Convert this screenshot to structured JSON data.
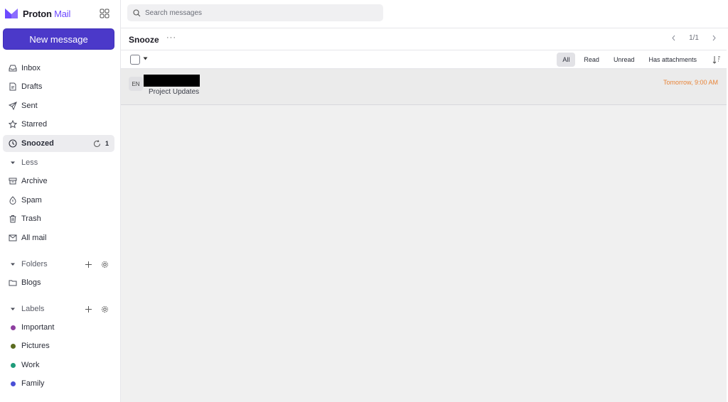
{
  "app": {
    "brand_name": "Proton",
    "brand_product": "Mail"
  },
  "sidebar": {
    "new_message_label": "New message",
    "items": [
      {
        "label": "Inbox",
        "icon": "inbox-icon"
      },
      {
        "label": "Drafts",
        "icon": "drafts-icon"
      },
      {
        "label": "Sent",
        "icon": "sent-icon"
      },
      {
        "label": "Starred",
        "icon": "star-icon"
      },
      {
        "label": "Snoozed",
        "icon": "clock-icon",
        "count": "1",
        "active": true
      },
      {
        "label": "Less",
        "icon": "caret-down-icon"
      },
      {
        "label": "Archive",
        "icon": "archive-icon"
      },
      {
        "label": "Spam",
        "icon": "spam-icon"
      },
      {
        "label": "Trash",
        "icon": "trash-icon"
      },
      {
        "label": "All mail",
        "icon": "all-mail-icon"
      }
    ],
    "folders": {
      "label": "Folders",
      "items": [
        {
          "label": "Blogs",
          "icon": "folder-icon"
        }
      ]
    },
    "labels": {
      "label": "Labels",
      "items": [
        {
          "label": "Important",
          "color": "#8e3fa0"
        },
        {
          "label": "Pictures",
          "color": "#5b6b1f"
        },
        {
          "label": "Work",
          "color": "#1f9c7a"
        },
        {
          "label": "Family",
          "color": "#4a4fd6"
        }
      ]
    }
  },
  "search": {
    "placeholder": "Search messages"
  },
  "toolbar": {
    "title": "Snooze",
    "more": "···",
    "page_indicator": "1/1"
  },
  "filters": {
    "items": [
      "All",
      "Read",
      "Unread",
      "Has attachments"
    ],
    "active": "All"
  },
  "messages": [
    {
      "avatar_initials": "EN",
      "subject": "Project Updates",
      "snooze_time": "Tomorrow, 9:00 AM"
    }
  ],
  "colors": {
    "accent": "#6d4aff",
    "new_message_bg": "#4b39c9",
    "snooze_time": "#e8853a"
  }
}
